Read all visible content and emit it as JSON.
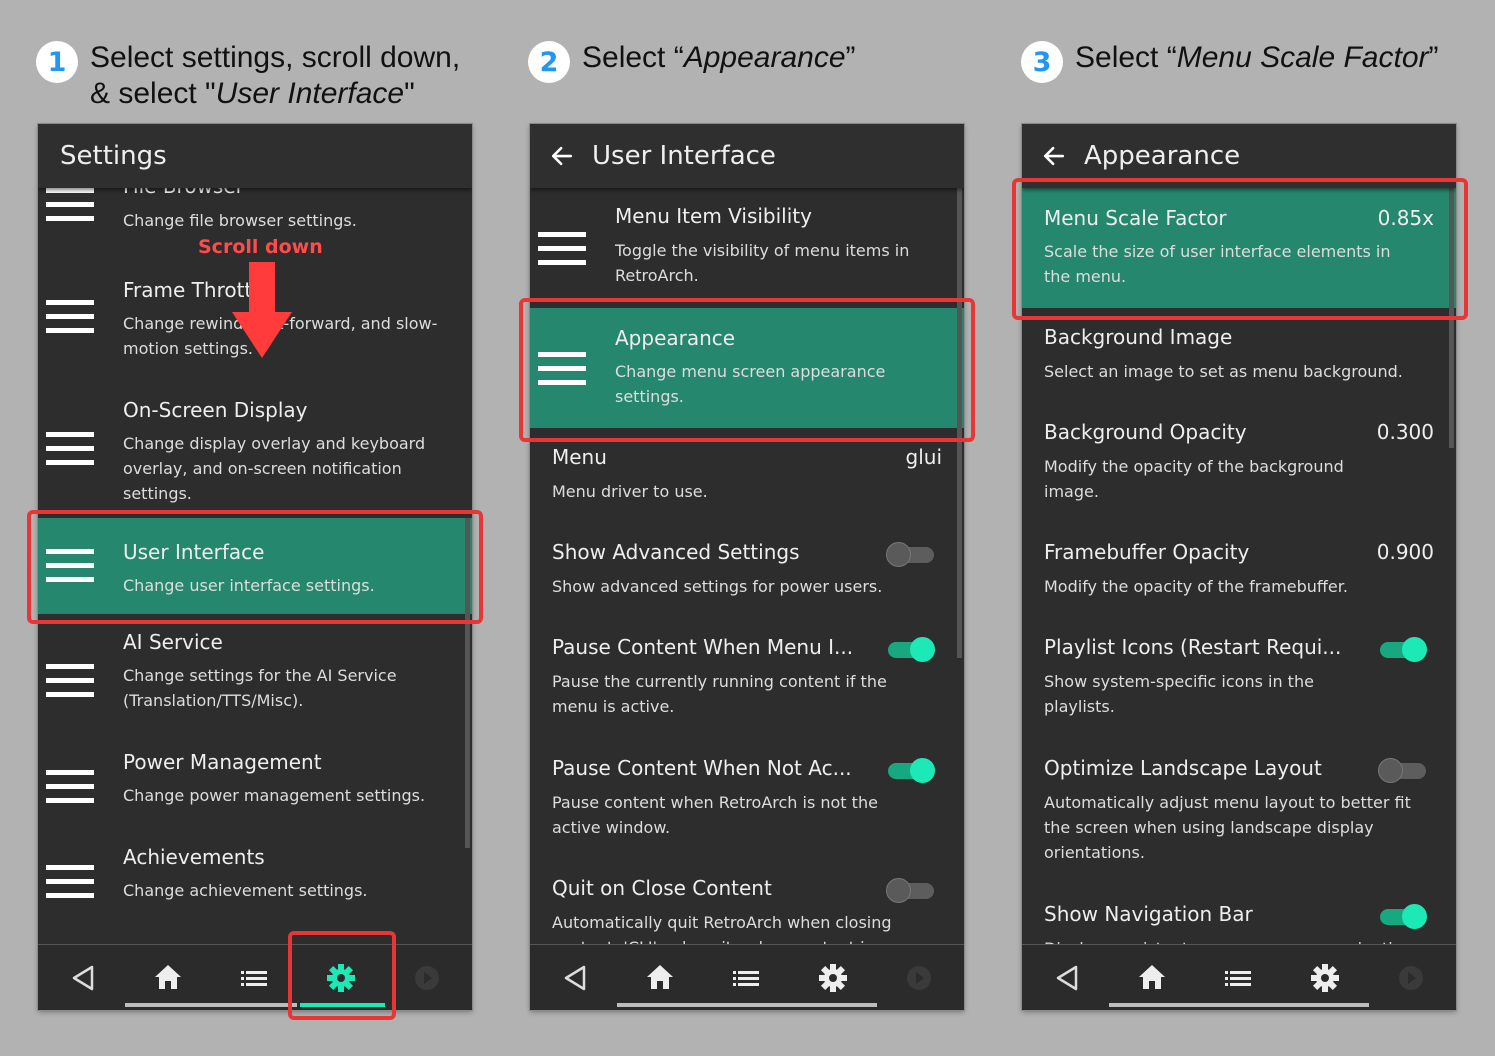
{
  "steps": [
    {
      "number": "1",
      "line1": "Select settings, scroll down,",
      "line2_prefix": "& select \"",
      "line2_italic": "User Interface",
      "line2_suffix": "\""
    },
    {
      "number": "2",
      "prefix": "Select “",
      "italic": "Appearance",
      "suffix": "”"
    },
    {
      "number": "3",
      "prefix": "Select “",
      "italic": "Menu Scale Factor",
      "suffix": "”"
    }
  ],
  "panel1": {
    "title": "Settings",
    "annotation": "Scroll down",
    "items": [
      {
        "label": "File Browser",
        "sub": "Change file browser settings."
      },
      {
        "label": "Frame Throttle",
        "sub": "Change rewind, fast-forward, and slow-motion settings."
      },
      {
        "label": "On-Screen Display",
        "sub": "Change display overlay and keyboard overlay, and on-screen notification settings."
      },
      {
        "label": "User Interface",
        "sub": "Change user interface settings."
      },
      {
        "label": "AI Service",
        "sub": "Change settings for the AI Service (Translation/TTS/Misc)."
      },
      {
        "label": "Power Management",
        "sub": "Change power management settings."
      },
      {
        "label": "Achievements",
        "sub": "Change achievement settings."
      }
    ]
  },
  "panel2": {
    "title": "User Interface",
    "items": [
      {
        "label": "Menu Item Visibility",
        "sub": "Toggle the visibility of menu items in RetroArch."
      },
      {
        "label": "Appearance",
        "sub": "Change menu screen appearance settings."
      },
      {
        "label": "Menu",
        "sub": "Menu driver to use.",
        "value": "glui"
      },
      {
        "label": "Show Advanced Settings",
        "sub": "Show advanced settings for power users.",
        "toggle": "off"
      },
      {
        "label": "Pause Content When Menu I...",
        "sub": "Pause the currently running content if the menu is active.",
        "toggle": "on"
      },
      {
        "label": "Pause Content When Not Ac...",
        "sub": "Pause content when RetroArch is not the active window.",
        "toggle": "on"
      },
      {
        "label": "Quit on Close Content",
        "sub": "Automatically quit RetroArch when closing content. 'CLI' only quits when content is launched",
        "toggle": "off"
      }
    ]
  },
  "panel3": {
    "title": "Appearance",
    "items": [
      {
        "label": "Menu Scale Factor",
        "sub": "Scale the size of user interface elements in the menu.",
        "value": "0.85x"
      },
      {
        "label": "Background Image",
        "sub": "Select an image to set as menu background."
      },
      {
        "label": "Background Opacity",
        "sub": "Modify the opacity of the background image.",
        "value": "0.300"
      },
      {
        "label": "Framebuffer Opacity",
        "sub": "Modify the opacity of the framebuffer.",
        "value": "0.900"
      },
      {
        "label": "Playlist Icons (Restart Requi...",
        "sub": "Show system-specific icons in the playlists.",
        "toggle": "on"
      },
      {
        "label": "Optimize Landscape Layout",
        "sub": "Automatically adjust menu layout to better fit the screen when using landscape display orientations.",
        "toggle": "off"
      },
      {
        "label": "Show Navigation Bar",
        "sub": "Display persistent on-screen menu navigation",
        "toggle": "on"
      }
    ]
  },
  "colors": {
    "accent": "#1de9b6",
    "selected": "#26876f",
    "highlight": "#e83535",
    "step_number": "#2196f3"
  },
  "icons": [
    "back-arrow-icon",
    "home-icon",
    "list-icon",
    "gear-icon",
    "forward-icon",
    "menu-icon"
  ]
}
